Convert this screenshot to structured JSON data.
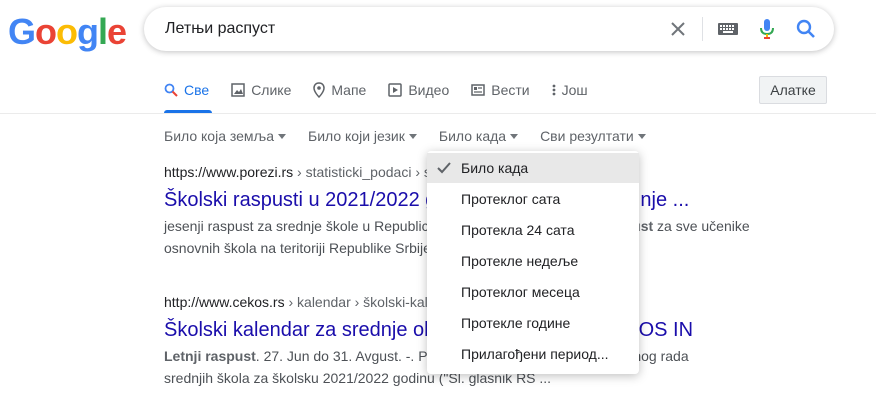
{
  "logo": {
    "letters": [
      "G",
      "o",
      "o",
      "g",
      "l",
      "e"
    ],
    "colors": [
      "#4285F4",
      "#EA4335",
      "#FBBC05",
      "#4285F4",
      "#34A853",
      "#EA4335"
    ]
  },
  "search": {
    "query": "Летњи распуст"
  },
  "icons": {
    "clear": "close-icon",
    "keyboard": "keyboard-icon",
    "voice": "microphone-icon",
    "search": "search-icon"
  },
  "tabs": [
    {
      "label": "Све",
      "icon": "search-icon",
      "active": true
    },
    {
      "label": "Слике",
      "icon": "image-icon"
    },
    {
      "label": "Мапе",
      "icon": "map-pin-icon"
    },
    {
      "label": "Видео",
      "icon": "video-icon"
    },
    {
      "label": "Вести",
      "icon": "news-icon"
    },
    {
      "label": "Још",
      "icon": "more-vert-icon"
    }
  ],
  "tools_label": "Алатке",
  "filters": [
    "Било која земља",
    "Било који језик",
    "Било када",
    "Сви резултати"
  ],
  "results": [
    {
      "cite_domain": "https://www.porezi.rs",
      "cite_path": " › statisticki_podaci › s",
      "title_left": "Školski raspusti u 2021/2022 g",
      "title_right": "nje ...",
      "snippet_line1_left": "jesenji raspust za srednje škole u Republic",
      "snippet_line1_bold": "pust",
      "snippet_line1_right": " za sve učenike",
      "snippet_line2": "osnovnih škola na teritoriji Republike Srbije"
    },
    {
      "cite_domain": "http://www.cekos.rs",
      "cite_path": " › kalendar › školski-kal",
      "title_left": "Školski kalendar za srednje ob",
      "title_right": "KOS IN",
      "snippet_line1_bold": "Letnji raspust",
      "snippet_line1_left": ". 27. Jun do 31. Avgust. -. P",
      "snippet_line1_right": "spitnog rada",
      "snippet_line2": "srednjih škola za školsku 2021/2022 godinu (\"Sl. glasnik RS ..."
    }
  ],
  "dropdown": {
    "items": [
      "Било када",
      "Протеклог сата",
      "Протекла 24 сата",
      "Протекле недеље",
      "Протеклог месеца",
      "Протекле године",
      "Прилагођени период..."
    ],
    "selected_index": 0
  },
  "colors": {
    "accent": "#1a73e8",
    "link": "#1a0dab"
  }
}
